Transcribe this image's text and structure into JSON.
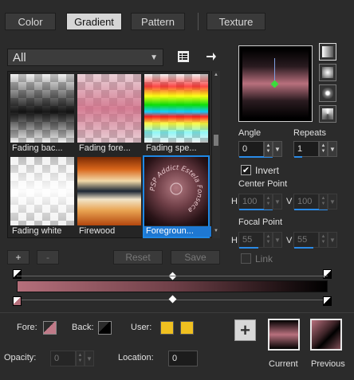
{
  "tabs": [
    {
      "label": "Color",
      "active": false
    },
    {
      "label": "Gradient",
      "active": true
    },
    {
      "label": "Pattern",
      "active": false
    },
    {
      "label": "Texture",
      "active": false
    }
  ],
  "category": {
    "value": "All"
  },
  "gallery": {
    "items": [
      {
        "label": "Fading bac...",
        "selected": false
      },
      {
        "label": "Fading fore...",
        "selected": false
      },
      {
        "label": "Fading spe...",
        "selected": false
      },
      {
        "label": "Fading white",
        "selected": false
      },
      {
        "label": "Firewood",
        "selected": false
      },
      {
        "label": "Foregroun...",
        "selected": true
      }
    ],
    "watermark": "PSP Addict Estela Fonseca"
  },
  "editor_buttons": {
    "add": "+",
    "remove": "-",
    "reset": "Reset",
    "save": "Save"
  },
  "preview": {
    "angle_label": "Angle",
    "angle_value": "0",
    "repeats_label": "Repeats",
    "repeats_value": "1",
    "invert_label": "Invert",
    "invert_checked": true,
    "center_point_label": "Center Point",
    "center_h_label": "H",
    "center_h_value": "100",
    "center_v_label": "V",
    "center_v_value": "100",
    "focal_point_label": "Focal Point",
    "focal_h_label": "H",
    "focal_h_value": "55",
    "focal_v_label": "V",
    "focal_v_value": "55",
    "link_label": "Link",
    "link_checked": false
  },
  "bottom": {
    "fore_label": "Fore:",
    "back_label": "Back:",
    "user_label": "User:",
    "opacity_label": "Opacity:",
    "opacity_value": "0",
    "location_label": "Location:",
    "location_value": "0",
    "add_button": "+",
    "current_label": "Current",
    "previous_label": "Previous"
  },
  "colors": {
    "accent": "#1e78d2",
    "gradient_start": "#b56f7b",
    "gradient_end": "#000000",
    "user_color": "#f0c020"
  },
  "icons": {
    "list_view": "list-icon",
    "arrow_right": "arrow-right-icon"
  }
}
